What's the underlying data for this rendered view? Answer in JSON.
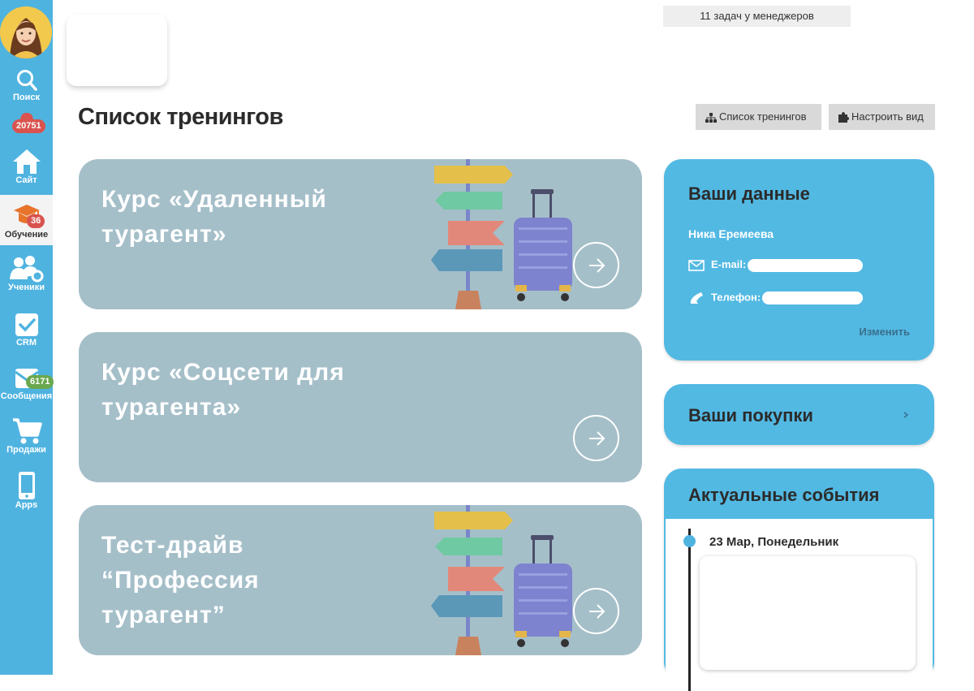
{
  "sidebar": {
    "items": [
      {
        "label": "Поиск",
        "icon": "search-icon"
      },
      {
        "label": "Сайт",
        "icon": "home-icon",
        "badge": "20751"
      },
      {
        "label": "Обучение",
        "icon": "graduation-cap-icon",
        "badge": "36",
        "active": true
      },
      {
        "label": "Ученики",
        "icon": "students-icon"
      },
      {
        "label": "CRM",
        "icon": "checkbox-icon"
      },
      {
        "label": "Сообщения",
        "icon": "messages-icon",
        "badge": "6171"
      },
      {
        "label": "Продажи",
        "icon": "cart-icon"
      },
      {
        "label": "Apps",
        "icon": "phone-icon"
      }
    ]
  },
  "header": {
    "tasks_banner": "11 задач у менеджеров",
    "page_title": "Список тренингов",
    "buttons": [
      {
        "label": "Список тренингов",
        "icon": "sitemap-icon"
      },
      {
        "label": "Настроить вид",
        "icon": "puzzle-icon"
      }
    ]
  },
  "courses": [
    {
      "title": "Курс «Удаленный турагент»"
    },
    {
      "title": "Курс «Соцсети для турагента»"
    },
    {
      "title": "Тест-драйв “Профессия турагент”"
    }
  ],
  "profile": {
    "title": "Ваши данные",
    "name": "Ника Еремеева",
    "email_label": "E-mail:",
    "phone_label": "Телефон:",
    "edit_label": "Изменить"
  },
  "purchases": {
    "title": "Ваши покупки"
  },
  "events": {
    "title": "Актуальные события",
    "items": [
      {
        "date": "23 Мар, Понедельник"
      }
    ]
  },
  "colors": {
    "sidebar": "#4fb3e0",
    "card": "#52b9e3",
    "course_bg": "#a5bfc9",
    "badge_red": "#d9534f",
    "badge_green": "#6aa84f"
  }
}
